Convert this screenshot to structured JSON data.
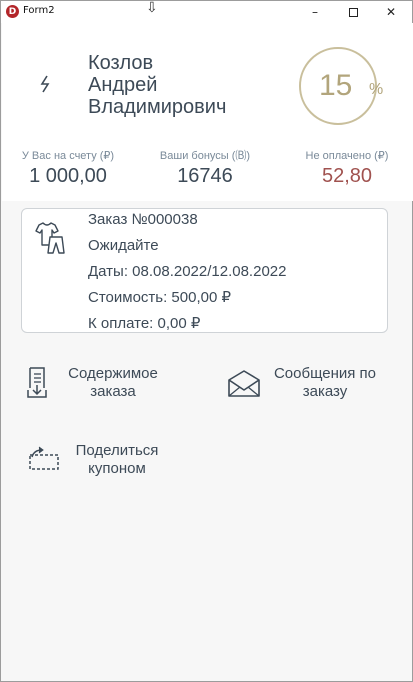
{
  "window": {
    "title": "Form2",
    "app_icon_letter": "D",
    "minimize_glyph": "–",
    "close_glyph": "✕",
    "cursor_glyph": "⇩"
  },
  "header": {
    "refresh_icon": "refresh-icon",
    "name_lines": [
      "Козлов",
      "Андрей",
      "Владимирович"
    ],
    "discount": {
      "value": "15",
      "unit": "%"
    },
    "stats": [
      {
        "label": "У Вас на счету (₽)",
        "value": "1 000,00"
      },
      {
        "label": "Ваши бонусы (🄑)",
        "value": "16746"
      },
      {
        "label": "Не оплачено (₽)",
        "value": "52,80"
      }
    ]
  },
  "order": {
    "icon": "clothes-icon",
    "lines": [
      "Заказ №000038",
      "Ожидайте",
      "Даты: 08.08.2022/12.08.2022",
      "Стоимость: 500,00 ₽",
      "К оплате: 0,00 ₽"
    ]
  },
  "actions": {
    "contents": {
      "label": "Содержимое заказа",
      "icon": "document-download-icon"
    },
    "messages": {
      "label": "Сообщения по заказу",
      "icon": "envelope-icon"
    },
    "share": {
      "label": "Поделиться купоном",
      "icon": "share-coupon-icon"
    }
  },
  "colors": {
    "accent_gold": "#b2a57c",
    "unpaid_red": "#a0524f",
    "text": "#3d4a57"
  }
}
